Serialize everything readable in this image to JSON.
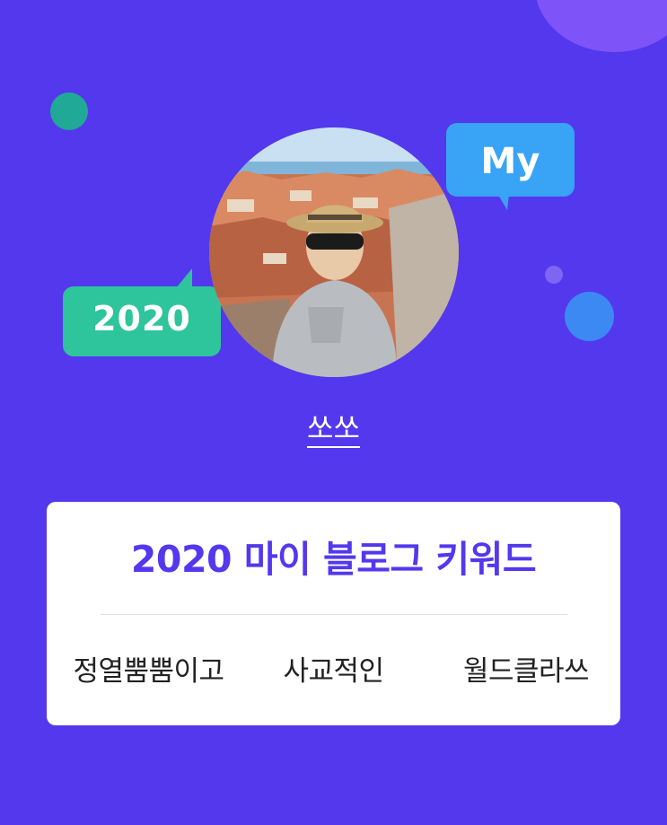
{
  "bubbles": {
    "my": "My",
    "year": "2020"
  },
  "profile": {
    "username": "쏘쏘"
  },
  "card": {
    "title": "2020 마이 블로그 키워드",
    "keywords": [
      "정열뿜뿜이고",
      "사교적인",
      "월드클라쓰"
    ]
  },
  "colors": {
    "background": "#5338ee",
    "accent_teal": "#2ec49c",
    "accent_blue": "#39a3f6",
    "card_title": "#5338ee"
  }
}
